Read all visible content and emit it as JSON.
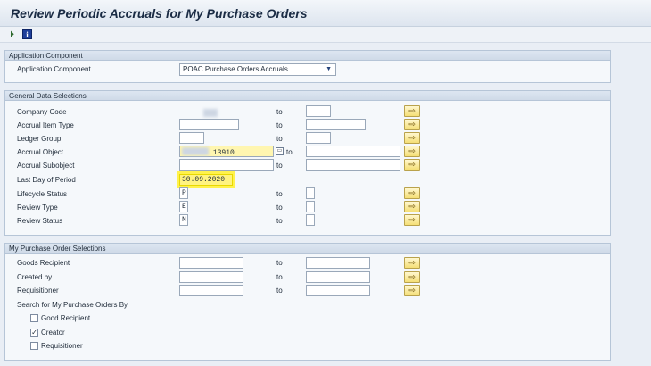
{
  "title": "Review Periodic Accruals for My Purchase Orders",
  "toolbar": {
    "execute_icon": "execute-clock-icon",
    "info_icon": "info-icon",
    "info_text": "i"
  },
  "group_app": {
    "header": "Application Component",
    "label": "Application Component",
    "value": "POAC Purchase Orders Accruals",
    "arrow": "▼"
  },
  "group_general": {
    "header": "General Data Selections",
    "to": "to",
    "arrow_glyph": "⇨",
    "rows": [
      {
        "label": "Company Code",
        "low": "",
        "high": ""
      },
      {
        "label": "Accrual Item Type",
        "low": "",
        "high": ""
      },
      {
        "label": "Ledger Group",
        "low": "",
        "high": ""
      },
      {
        "label": "Accrual Object",
        "low": "13910",
        "high": ""
      },
      {
        "label": "Accrual Subobject",
        "low": "",
        "high": ""
      },
      {
        "label": "Last Day of Period",
        "low": "30.09.2020"
      },
      {
        "label": "Lifecycle Status",
        "low": "P",
        "high": ""
      },
      {
        "label": "Review Type",
        "low": "E",
        "high": ""
      },
      {
        "label": "Review Status",
        "low": "N",
        "high": ""
      }
    ]
  },
  "group_po": {
    "header": "My Purchase Order Selections",
    "to": "to",
    "rows": [
      {
        "label": "Goods Recipient"
      },
      {
        "label": "Created by"
      },
      {
        "label": "Requisitioner"
      }
    ],
    "search_label": "Search for My Purchase Orders By",
    "checkboxes": [
      {
        "label": "Good Recipient",
        "checked": false,
        "mark": ""
      },
      {
        "label": "Creator",
        "checked": true,
        "mark": "✓"
      },
      {
        "label": "Requisitioner",
        "checked": false,
        "mark": ""
      }
    ]
  }
}
